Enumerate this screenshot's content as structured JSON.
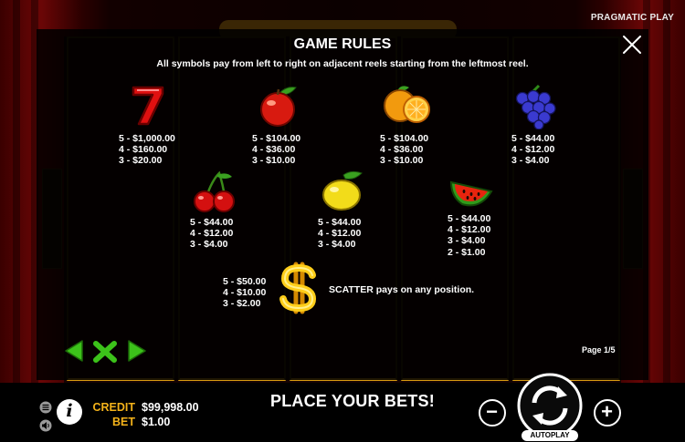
{
  "brand": "PRAGMATIC PLAY",
  "rules": {
    "title": "GAME RULES",
    "subtitle": "All symbols pay from left to right on adjacent reels starting from the leftmost reel.",
    "symbols": [
      {
        "name": "seven",
        "pays": [
          "5 - $1,000.00",
          "4 - $160.00",
          "3 - $20.00"
        ]
      },
      {
        "name": "apple",
        "pays": [
          "5 - $104.00",
          "4 - $36.00",
          "3 - $10.00"
        ]
      },
      {
        "name": "orange",
        "pays": [
          "5 - $104.00",
          "4 - $36.00",
          "3 - $10.00"
        ]
      },
      {
        "name": "grapes",
        "pays": [
          "5 - $44.00",
          "4 - $12.00",
          "3 - $4.00"
        ]
      },
      {
        "name": "cherries",
        "pays": [
          "5 - $44.00",
          "4 - $12.00",
          "3 - $4.00"
        ]
      },
      {
        "name": "lemon",
        "pays": [
          "5 - $44.00",
          "4 - $12.00",
          "3 - $4.00"
        ]
      },
      {
        "name": "watermelon",
        "pays": [
          "5 - $44.00",
          "4 - $12.00",
          "3 - $4.00",
          "2 - $1.00"
        ]
      },
      {
        "name": "dollar-scatter",
        "pays": [
          "5 - $50.00",
          "4 - $10.00",
          "3 - $2.00"
        ]
      }
    ],
    "scatter_text": "SCATTER pays on any position.",
    "page_indicator": "Page 1/5"
  },
  "bottom": {
    "credit_label": "CREDIT",
    "credit_value": "$99,998.00",
    "bet_label": "BET",
    "bet_value": "$1.00",
    "message": "PLACE YOUR BETS!",
    "minus": "−",
    "plus": "+",
    "autoplay": "AUTOPLAY"
  },
  "colors": {
    "accent": "#f3b21a",
    "nav_green": "#3cc21a",
    "panel": "#000000"
  }
}
